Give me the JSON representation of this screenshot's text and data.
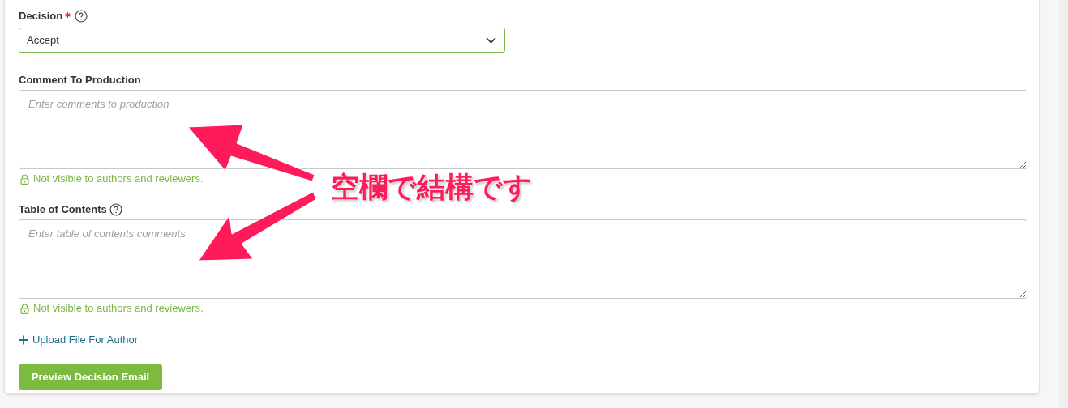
{
  "fields": [
    {
      "kind": "select",
      "label": "Decision",
      "required": true,
      "help": true,
      "value": "Accept"
    },
    {
      "kind": "textarea",
      "label": "Comment To Production",
      "required": false,
      "help": false,
      "placeholder": "Enter comments to production",
      "note": "Not visible to authors and reviewers."
    },
    {
      "kind": "textarea",
      "label": "Table of Contents",
      "required": false,
      "help": true,
      "placeholder": "Enter table of contents comments",
      "note": "Not visible to authors and reviewers."
    }
  ],
  "upload_link": "Upload File For Author",
  "preview_button": "Preview Decision Email",
  "annotation": {
    "text": "空欄で結構です"
  }
}
